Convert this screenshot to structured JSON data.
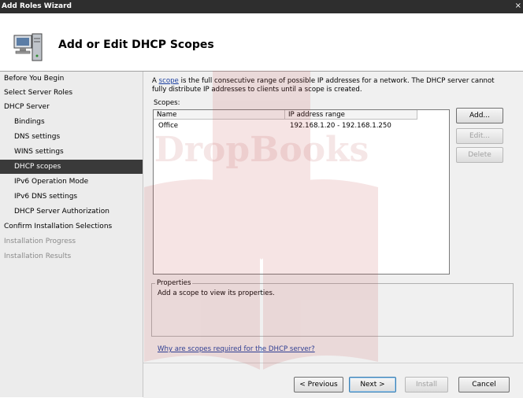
{
  "window": {
    "title": "Add Roles Wizard",
    "close_glyph": "×"
  },
  "header": {
    "title": "Add or Edit DHCP Scopes",
    "icon": "server-computer-icon"
  },
  "nav": {
    "items": [
      {
        "label": "Before You Begin"
      },
      {
        "label": "Select Server Roles"
      },
      {
        "label": "DHCP Server"
      },
      {
        "label": "Bindings"
      },
      {
        "label": "DNS settings"
      },
      {
        "label": "WINS settings"
      },
      {
        "label": "DHCP scopes"
      },
      {
        "label": "IPv6 Operation Mode"
      },
      {
        "label": "IPv6 DNS settings"
      },
      {
        "label": "DHCP Server Authorization"
      },
      {
        "label": "Confirm Installation Selections"
      },
      {
        "label": "Installation Progress"
      },
      {
        "label": "Installation Results"
      }
    ]
  },
  "main": {
    "desc_prefix": "A",
    "desc_link": "scope",
    "desc_line1": "is the full consecutive range of possible IP addresses for a network. The DHCP server cannot",
    "desc_line2": "fully distribute IP addresses to clients until a scope is created.",
    "scopes_label": "Scopes:",
    "columns": [
      "Name",
      "IP address range"
    ],
    "rows": [
      {
        "name": "Office",
        "range": "192.168.1.20 - 192.168.1.250"
      }
    ],
    "add_label": "Add...",
    "edit_label": "Edit...",
    "delete_label": "Delete",
    "properties_legend": "Properties",
    "properties_text": "Add a scope to view its properties.",
    "help_link": "Why are scopes required for the DHCP server?"
  },
  "footer": {
    "previous_label": "< Previous",
    "next_label": "Next >",
    "install_label": "Install",
    "cancel_label": "Cancel"
  },
  "watermark": {
    "text": "DropBooks"
  }
}
